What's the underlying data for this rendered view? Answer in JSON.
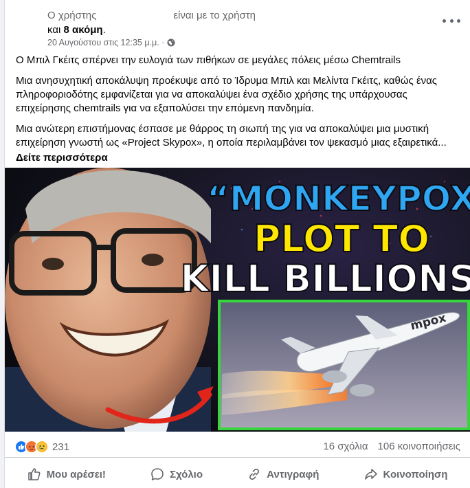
{
  "post": {
    "author_label": "Ο χρήστης",
    "with_label": "είναι με το χρήστη",
    "others_prefix": "και",
    "others_count": "8 ακόμη",
    "others_suffix": ".",
    "timestamp": "20 Αυγούστου στις 12:35 μ.μ. ·",
    "privacy_icon": "globe-icon",
    "more_icon": "more-options-icon"
  },
  "body": {
    "paragraphs": [
      "Ο Μπιλ Γκέιτς σπέρνει την ευλογιά των πιθήκων σε μεγάλες πόλεις μέσω Chemtrails",
      "Μια ανησυχητική αποκάλυψη προέκυψε από το Ίδρυμα Μπιλ και Μελίντα Γκέιτς, καθώς ένας πληροφοριοδότης εμφανίζεται για να αποκαλύψει ένα σχέδιο χρήσης της υπάρχουσας επιχείρησης chemtrails για να εξαπολύσει την επόμενη πανδημία.",
      "Μια ανώτερη επιστήμονας έσπασε με θάρρος τη σιωπή της για να αποκαλύψει μια μυστική επιχείρηση γνωστή ως «Project Skypox», η οποία περιλαμβάνει τον ψεκασμό μιας εξαιρετικά..."
    ],
    "see_more": "Δείτε περισσότερα"
  },
  "image": {
    "headline_line1": "“MONKEYPOX",
    "headline_line2": "PLOT TO",
    "headline_line3": "KILL BILLIONS”",
    "plane_label": "mpox",
    "colors": {
      "headline_blue": "#2fa6f2",
      "headline_yellow": "#ffe600",
      "frame_green": "#36d63c",
      "arrow_red": "#e1251b"
    }
  },
  "stats": {
    "reactions": [
      "like-icon",
      "angry-icon",
      "sad-icon"
    ],
    "reaction_count": "231",
    "comments": "16 σχόλια",
    "shares": "106 κοινοποιήσεις"
  },
  "actions": {
    "like": "Μου αρέσει!",
    "comment": "Σχόλιο",
    "copy": "Αντιγραφή",
    "share": "Κοινοποίηση"
  },
  "colors": {
    "fb_blue": "#1877f2",
    "secondary_text": "#65676b"
  }
}
